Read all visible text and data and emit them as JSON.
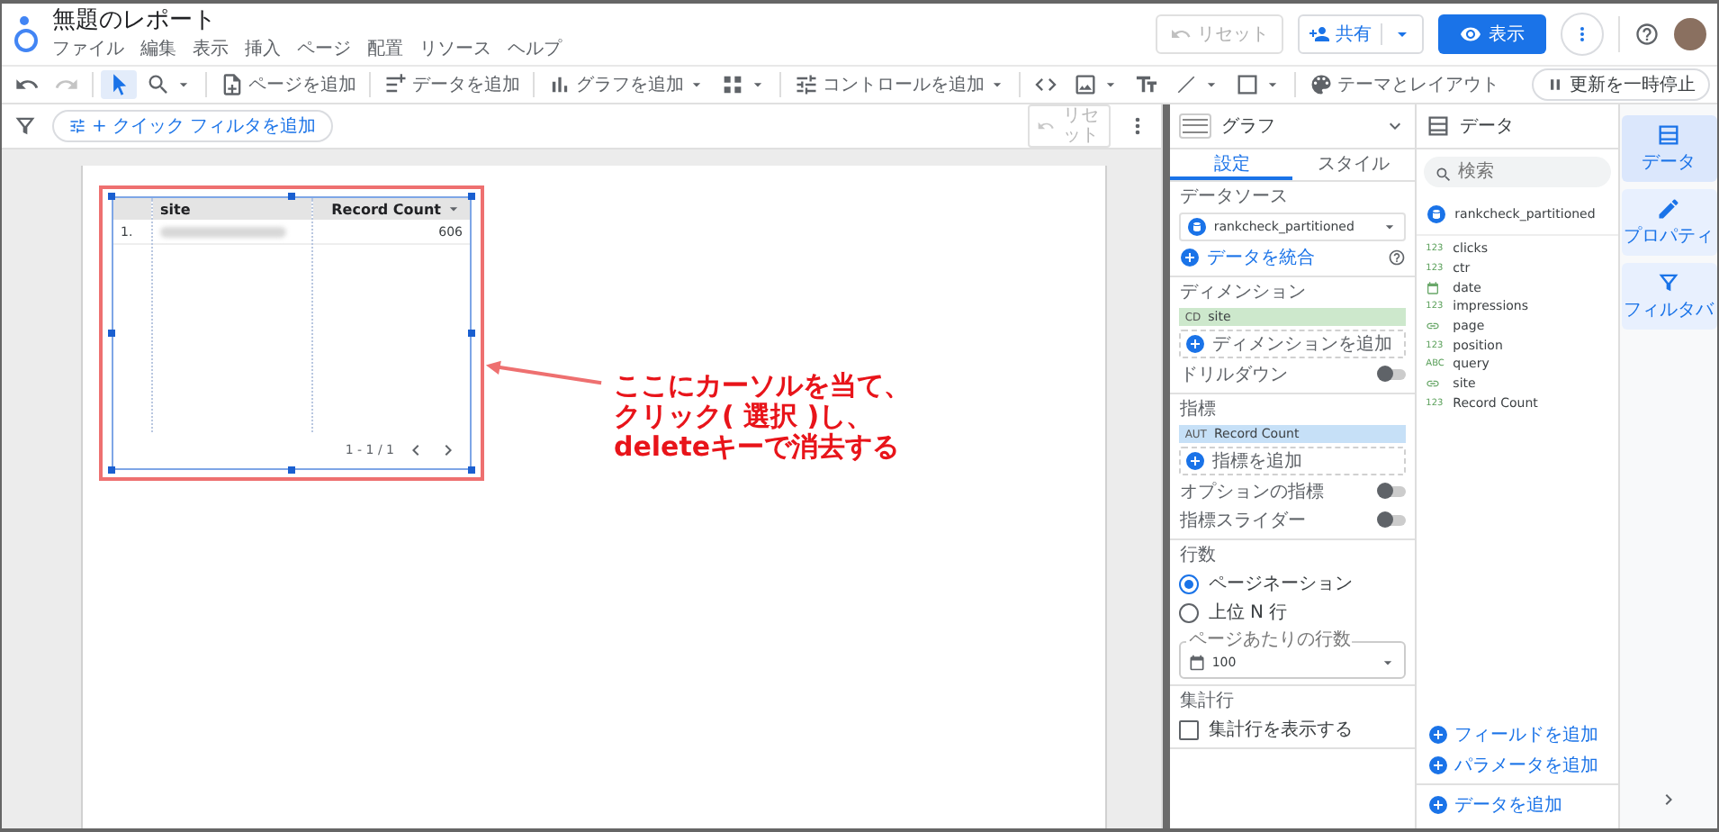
{
  "header": {
    "title": "無題のレポート",
    "menu": [
      "ファイル",
      "編集",
      "表示",
      "挿入",
      "ページ",
      "配置",
      "リソース",
      "ヘルプ"
    ],
    "reset": {
      "label": "リセット",
      "disabled": true
    },
    "share": {
      "label": "共有"
    },
    "view": {
      "label": "表示"
    }
  },
  "toolbar": {
    "items": [
      {
        "kind": "undo",
        "selected": false,
        "disabled": false,
        "caret": false
      },
      {
        "kind": "redo",
        "selected": false,
        "disabled": true,
        "caret": false
      },
      {
        "kind": "separator"
      },
      {
        "kind": "pointer",
        "selected": true,
        "disabled": false,
        "caret": false
      },
      {
        "kind": "zoom",
        "selected": false,
        "disabled": false,
        "caret": true
      },
      {
        "kind": "separator"
      },
      {
        "kind": "add-page",
        "label": "ページを追加",
        "selected": false,
        "disabled": false,
        "caret": false
      },
      {
        "kind": "separator"
      },
      {
        "kind": "add-data",
        "label": "データを追加",
        "selected": false,
        "disabled": false,
        "caret": false
      },
      {
        "kind": "separator"
      },
      {
        "kind": "add-chart",
        "label": "グラフを追加",
        "selected": false,
        "disabled": false,
        "caret": true
      },
      {
        "kind": "community",
        "selected": false,
        "disabled": false,
        "caret": true
      },
      {
        "kind": "separator"
      },
      {
        "kind": "control",
        "label": "コントロールを追加",
        "selected": false,
        "disabled": false,
        "caret": true
      },
      {
        "kind": "separator"
      },
      {
        "kind": "code",
        "selected": false,
        "disabled": false,
        "caret": false
      },
      {
        "kind": "image",
        "selected": false,
        "disabled": false,
        "caret": true
      },
      {
        "kind": "text",
        "selected": false,
        "disabled": false,
        "caret": false
      },
      {
        "kind": "line",
        "selected": false,
        "disabled": false,
        "caret": true
      },
      {
        "kind": "rect",
        "selected": false,
        "disabled": false,
        "caret": true
      },
      {
        "kind": "separator"
      },
      {
        "kind": "theme",
        "label": "テーマとレイアウト",
        "selected": false,
        "disabled": false,
        "caret": false
      }
    ],
    "pause": {
      "label": "更新を一時停止"
    }
  },
  "filter_bar": {
    "chip": "+ クイック フィルタを追加",
    "reset": {
      "label": "リセット",
      "disabled": true
    }
  },
  "canvas": {
    "table": {
      "columns": [
        {
          "label": "site",
          "sorted": false
        },
        {
          "label": "Record Count",
          "sorted": true
        }
      ],
      "rows": [
        {
          "index": "1.",
          "value": "606"
        }
      ],
      "pagination": "1 - 1 / 1"
    },
    "note_lines": [
      "ここにカーソルを当て、",
      "クリック( 選択 )し、",
      "deleteキーで消去する"
    ]
  },
  "properties": {
    "title": "グラフ",
    "tabs": [
      {
        "label": "設定",
        "selected": true
      },
      {
        "label": "スタイル",
        "selected": false
      }
    ],
    "source_label": "データソース",
    "source": "rankcheck_partitioned",
    "blend": "データを統合",
    "dimension_label": "ディメンション",
    "dimension": {
      "badge": "CD",
      "name": "site"
    },
    "add_dimension": "ディメンションを追加",
    "drilldown": {
      "label": "ドリルダウン",
      "on": false
    },
    "metric_label": "指標",
    "metric": {
      "badge": "AUT",
      "name": "Record Count"
    },
    "add_metric": "指標を追加",
    "toggles": [
      {
        "label": "オプションの指標",
        "on": false
      },
      {
        "label": "指標スライダー",
        "on": false
      }
    ],
    "rows_label": "行数",
    "radios": [
      {
        "label": "ページネーション",
        "selected": true
      },
      {
        "label": "上位 N 行",
        "selected": false
      }
    ],
    "per_page": {
      "label": "ページあたりの行数",
      "value": "100"
    },
    "summary_label": "集計行",
    "summary": {
      "label": "集計行を表示する",
      "checked": false
    }
  },
  "data_panel": {
    "title": "データ",
    "search": {
      "placeholder": "検索"
    },
    "source": "rankcheck_partitioned",
    "fields": [
      {
        "name": "clicks",
        "kind": "number",
        "badge": "123"
      },
      {
        "name": "ctr",
        "kind": "number",
        "badge": "123"
      },
      {
        "name": "date",
        "kind": "date"
      },
      {
        "name": "impressions",
        "kind": "number",
        "badge": "123"
      },
      {
        "name": "page",
        "kind": "url"
      },
      {
        "name": "position",
        "kind": "number",
        "badge": "123"
      },
      {
        "name": "query",
        "kind": "text",
        "badge": "ABC"
      },
      {
        "name": "site",
        "kind": "url"
      },
      {
        "name": "Record Count",
        "kind": "number",
        "badge": "123"
      }
    ],
    "add_field": "フィールドを追加",
    "add_parameter": "パラメータを追加",
    "add_data": "データを追加"
  },
  "rail": [
    {
      "kind": "data",
      "label": "データ",
      "selected": true
    },
    {
      "kind": "properties",
      "label": "プロパティ",
      "selected": false
    },
    {
      "kind": "filter",
      "label": "フィルタバ",
      "selected": false
    }
  ]
}
